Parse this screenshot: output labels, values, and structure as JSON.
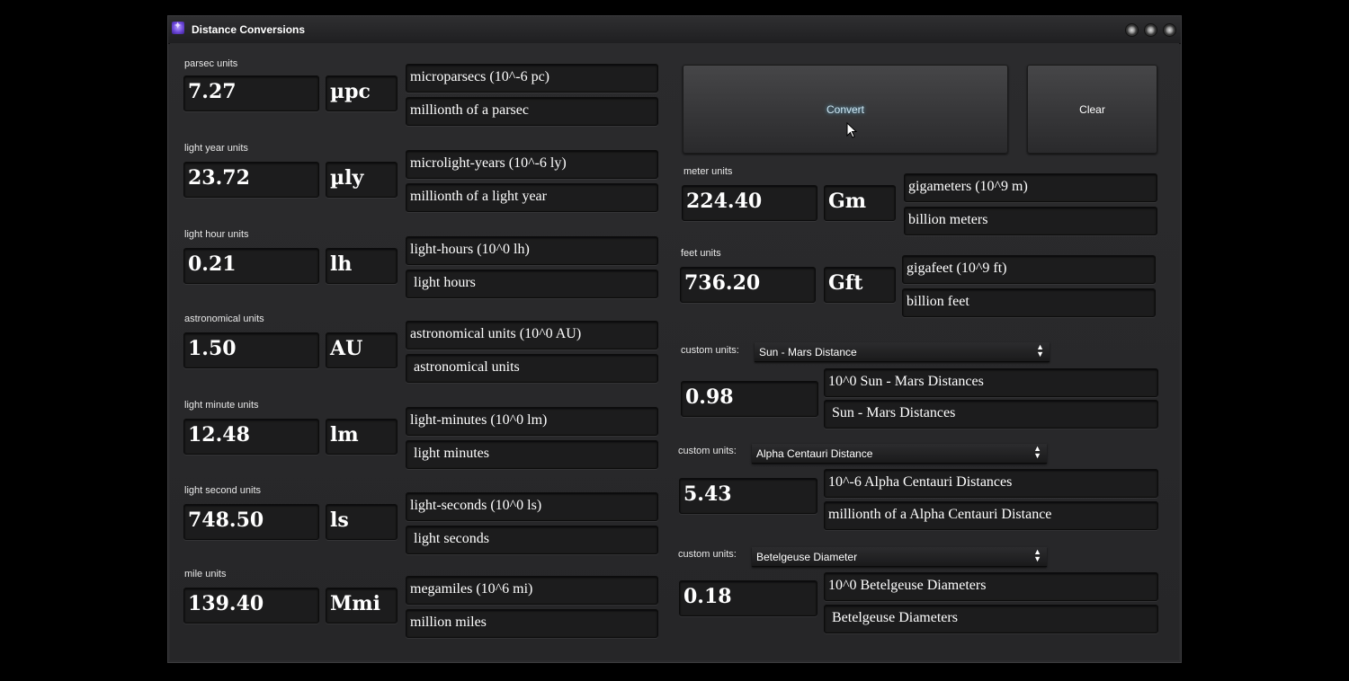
{
  "window": {
    "title": "Distance Conversions",
    "app_icon": "sparkle-app-icon"
  },
  "left_groups": [
    {
      "label": "parsec units",
      "value": "7.27",
      "unit": "µpc",
      "name": "microparsecs  (10^-6 pc)",
      "description": "millionth of a parsec"
    },
    {
      "label": "light year units",
      "value": "23.72",
      "unit": "µly",
      "name": "microlight-years  (10^-6 ly)",
      "description": "millionth of a light year"
    },
    {
      "label": "light hour units",
      "value": "0.21",
      "unit": "lh",
      "name": "light-hours  (10^0 lh)",
      "description": " light hours"
    },
    {
      "label": "astronomical units",
      "value": "1.50",
      "unit": "AU",
      "name": "astronomical units  (10^0 AU)",
      "description": " astronomical units"
    },
    {
      "label": "light minute units",
      "value": "12.48",
      "unit": "lm",
      "name": "light-minutes  (10^0 lm)",
      "description": " light minutes"
    },
    {
      "label": "light second units",
      "value": "748.50",
      "unit": "ls",
      "name": "light-seconds  (10^0 ls)",
      "description": " light seconds"
    },
    {
      "label": "mile units",
      "value": "139.40",
      "unit": "Mmi",
      "name": "megamiles  (10^6 mi)",
      "description": "million miles"
    }
  ],
  "buttons": {
    "convert": "Convert",
    "clear": "Clear"
  },
  "right_groups": [
    {
      "label": "meter units",
      "value": "224.40",
      "unit": "Gm",
      "name": "gigameters  (10^9 m)",
      "description": "billion meters"
    },
    {
      "label": "feet units",
      "value": "736.20",
      "unit": "Gft",
      "name": "gigafeet  (10^9 ft)",
      "description": "billion feet"
    }
  ],
  "custom_groups": [
    {
      "label": "custom units:",
      "selected": "Sun - Mars Distance",
      "value": "0.98",
      "name": "10^0 Sun - Mars Distances",
      "description": " Sun - Mars Distances"
    },
    {
      "label": "custom units:",
      "selected": "Alpha Centauri Distance",
      "value": "5.43",
      "name": "10^-6 Alpha Centauri Distances",
      "description": "millionth of a Alpha Centauri Distance"
    },
    {
      "label": "custom units:",
      "selected": "Betelgeuse Diameter",
      "value": "0.18",
      "name": "10^0 Betelgeuse Diameters",
      "description": " Betelgeuse Diameters"
    }
  ]
}
